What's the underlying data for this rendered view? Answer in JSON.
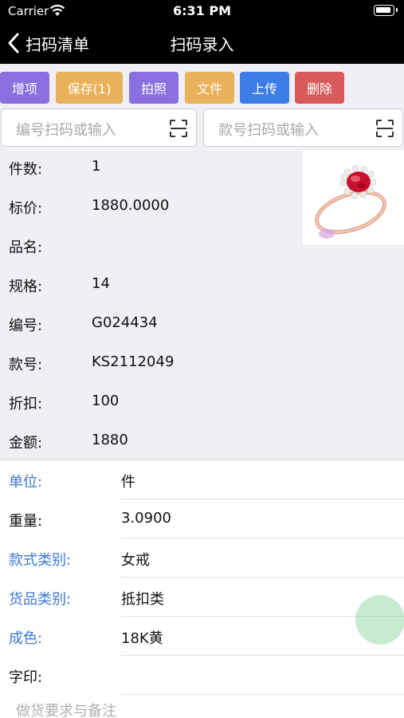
{
  "status_bar": {
    "carrier": "Carrier",
    "time": "6:31 PM"
  },
  "nav": {
    "back_label": "扫码清单",
    "title": "扫码录入"
  },
  "toolbar": {
    "buttons": [
      {
        "label": "增项",
        "color": "#8a6fe0"
      },
      {
        "label": "保存(1)",
        "color": "#e8b25a"
      },
      {
        "label": "拍照",
        "color": "#8a6fe0"
      },
      {
        "label": "文件",
        "color": "#e8b25a"
      },
      {
        "label": "上传",
        "color": "#3d7ee6"
      },
      {
        "label": "删除",
        "color": "#d85a5a"
      }
    ]
  },
  "scan": {
    "code_placeholder": "编号扫码或输入",
    "style_placeholder": "款号扫码或输入"
  },
  "info": {
    "rows": [
      {
        "label": "件数:",
        "value": "1"
      },
      {
        "label": "标价:",
        "value": "1880.0000"
      },
      {
        "label": "品名:",
        "value": ""
      },
      {
        "label": "规格:",
        "value": "14"
      },
      {
        "label": "编号:",
        "value": "G024434"
      },
      {
        "label": "款号:",
        "value": "KS2112049"
      },
      {
        "label": "折扣:",
        "value": "100"
      },
      {
        "label": "金额:",
        "value": "1880"
      }
    ]
  },
  "detail": {
    "rows": [
      {
        "label": "单位:",
        "value": "件",
        "selectable": true
      },
      {
        "label": "重量:",
        "value": "3.0900",
        "selectable": false
      },
      {
        "label": "款式类别:",
        "value": "女戒",
        "selectable": true
      },
      {
        "label": "货品类别:",
        "value": "抵扣类",
        "selectable": true
      },
      {
        "label": "成色:",
        "value": "18K黄",
        "selectable": true
      },
      {
        "label": "字印:",
        "value": "",
        "selectable": false
      }
    ],
    "remark_placeholder": "做货要求与备注"
  },
  "colors": {
    "link_blue": "#3a78d8",
    "panel_gray": "#efeff4",
    "float_button": "#82d296"
  }
}
